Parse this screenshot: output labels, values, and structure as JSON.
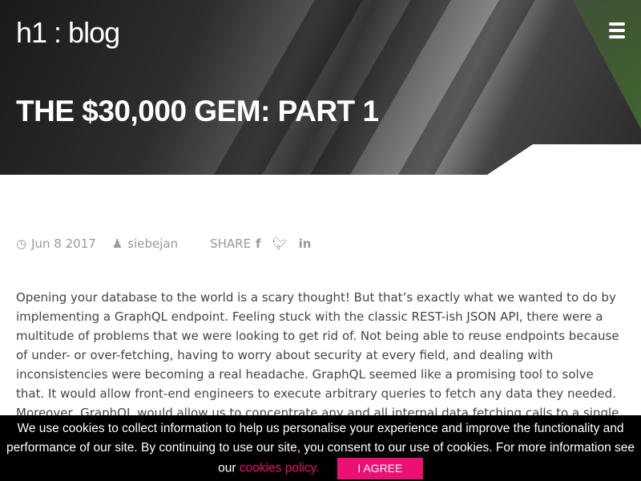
{
  "header": {
    "logo": "h1 : blog",
    "menu_icon": "hamburger-icon"
  },
  "post": {
    "title": "THE $30,000 GEM: PART 1",
    "date": "Jun 8 2017",
    "author": "siebejan",
    "share_label": "SHARE",
    "body": "Opening your database to the world is a scary thought! But that’s exactly what we wanted to do by implementing a GraphQL endpoint. Feeling stuck with the classic REST-ish JSON API, there were a multitude of problems that we were looking to get rid of. Not being able to reuse endpoints because of under- or over-fetching, having to worry about security at every field, and dealing with inconsistencies were becoming a real headache. GraphQL seemed like a promising tool to solve that. It would allow front-end engineers to execute arbitrary queries to fetch any data they needed. Moreover, GraphQL would allow us to concentrate any and all internal data fetching calls to a single endpoint. Meaning that engineers wouldn’t have to worry"
  },
  "cookie": {
    "text": "We use cookies to collect information to help us personalise your experience and improve the functionality and performance of our site. By continuing to use our site, you consent to our use of cookies. For more information see our",
    "link": "cookies policy.",
    "button": "I AGREE"
  },
  "colors": {
    "accent": "#ec1075"
  }
}
